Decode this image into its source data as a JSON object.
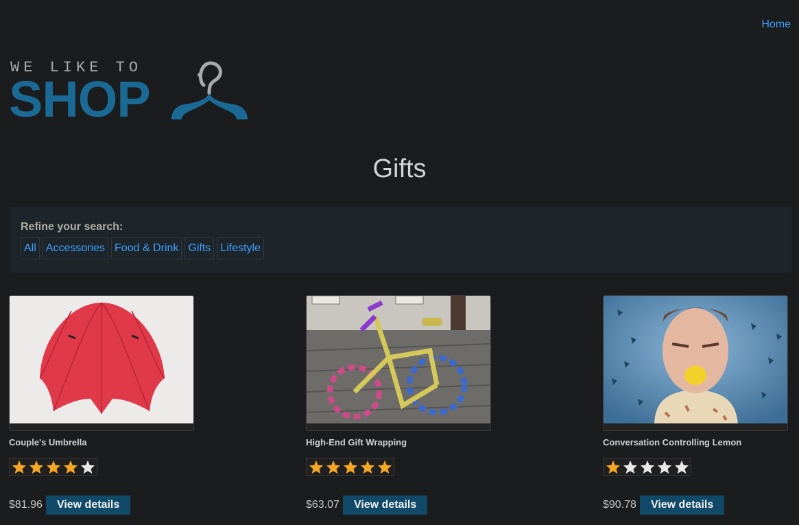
{
  "nav": {
    "home_label": "Home"
  },
  "logo": {
    "line1": "WE LIKE TO",
    "line2": "SHOP",
    "icon": "hanger-icon"
  },
  "page": {
    "title": "Gifts"
  },
  "refine": {
    "label": "Refine your search:",
    "filters": [
      "All",
      "Accessories",
      "Food & Drink",
      "Gifts",
      "Lifestyle"
    ]
  },
  "colors": {
    "background": "#1b1c1e",
    "link": "#3ea0ff",
    "brand": "#1a6a95",
    "button": "#114a68",
    "star_filled": "#f5a623",
    "star_empty": "#e8e8e8"
  },
  "products": [
    {
      "name": "Couple's Umbrella",
      "rating": 4,
      "rating_max": 5,
      "price": "$81.96",
      "button": "View details",
      "image": "red-umbrella"
    },
    {
      "name": "High-End Gift Wrapping",
      "rating": 5,
      "rating_max": 5,
      "price": "$63.07",
      "button": "View details",
      "image": "knitted-bicycle"
    },
    {
      "name": "Conversation Controlling Lemon",
      "rating": 1,
      "rating_max": 5,
      "price": "$90.78",
      "button": "View details",
      "image": "man-with-lemon"
    }
  ]
}
